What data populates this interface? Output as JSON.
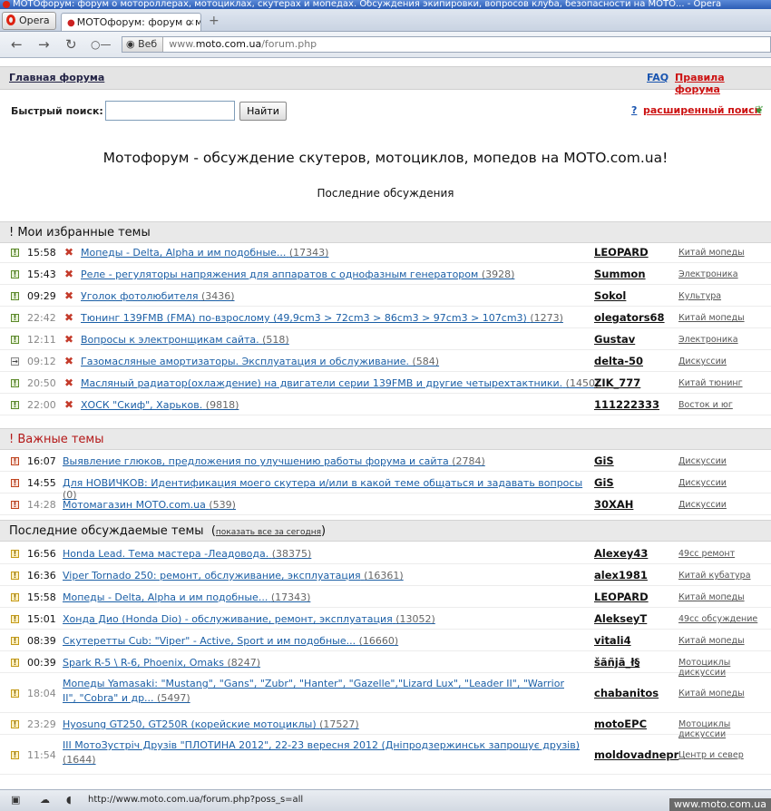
{
  "window": {
    "title": "МОТОфорум: форум о мотороллерах, мотоциклах, скутерах и мопедах. Обсуждения экипировки, вопросов клуба, безопасности на МОТО... - Opera"
  },
  "browser": {
    "opera_label": "Opera",
    "tab_label": "МОТОфорум: форум о м...",
    "tab_close": "×",
    "new_tab": "+",
    "web_label": "Веб",
    "url_prefix": "www.",
    "url_host": "moto.com.ua",
    "url_path": "/forum.php"
  },
  "nav": {
    "home": "Главная форума",
    "faq": "FAQ",
    "rules": "Правила форума"
  },
  "search": {
    "label": "Быстрый поиск:",
    "value": "",
    "button": "Найти",
    "adv_help": "?",
    "advanced": "расширенный поиск"
  },
  "headline": "Мотофорум - обсуждение скутеров, мотоциклов, мопедов на MOTO.com.ua!",
  "subhead": "Последние обсуждения",
  "sections": {
    "favorites": {
      "title": "! Мои избранные темы"
    },
    "important": {
      "title": "! Важные темы"
    },
    "recent": {
      "title": "Последние обсуждаемые темы",
      "open": "(",
      "show_all": "показать все за сегодня",
      "close": ")"
    }
  },
  "rows": [
    {
      "icon": "!",
      "time": "15:58",
      "old": false,
      "del": true,
      "title": "Мопеды - Delta, Alpha и им подобные...",
      "count": "(17343)",
      "author": "LEOPARD",
      "cat": "Китай мопеды"
    },
    {
      "icon": "!",
      "time": "15:43",
      "old": false,
      "del": true,
      "title": "Реле - регуляторы напряжения для аппаратов с однофазным генератором",
      "count": "(3928)",
      "author": "Summon",
      "cat": "Электроника"
    },
    {
      "icon": "!",
      "time": "09:29",
      "old": false,
      "del": true,
      "title": "Уголок фотолюбителя",
      "count": "(3436)",
      "author": "Sokol",
      "cat": "Культура"
    },
    {
      "icon": "!",
      "time": "22:42",
      "old": true,
      "del": true,
      "title": "Тюнинг 139FMB (FMA) по-взрослому (49,9cm3 > 72cm3 > 86cm3 > 97cm3 > 107cm3)",
      "count": "(1273)",
      "author": "olegators68",
      "cat": "Китай мопеды"
    },
    {
      "icon": "!",
      "time": "12:11",
      "old": true,
      "del": true,
      "title": "Вопросы к электронщикам сайта.",
      "count": "(518)",
      "author": "Gustav",
      "cat": "Электроника"
    },
    {
      "icon": "→",
      "time": "09:12",
      "old": true,
      "del": true,
      "title": "Газомасляные амортизаторы. Эксплуатация и обслуживание.",
      "count": "(584)",
      "author": "delta-50",
      "cat": "Дискуссии"
    },
    {
      "icon": "!",
      "time": "20:50",
      "old": true,
      "del": true,
      "title": "Масляный радиатор(охлаждение) на двигатели серии 139FMB и другие четырехтактники.",
      "count": "(1450)",
      "author": "ZIK_777",
      "cat": "Китай тюнинг"
    },
    {
      "icon": "!",
      "time": "22:00",
      "old": true,
      "del": true,
      "title": "ХОСК \"Скиф\", Харьков.",
      "count": "(9818)",
      "author": "111222333",
      "cat": "Восток и юг"
    },
    {
      "icon": "!",
      "time": "16:07",
      "old": false,
      "del": false,
      "title": "Выявление глюков, предложения по улучшению работы форума и сайта",
      "count": "(2784)",
      "author": "GiS",
      "cat": "Дискуссии"
    },
    {
      "icon": "!",
      "time": "14:55",
      "old": false,
      "del": false,
      "title": "Для НОВИЧКОВ: Идентификация моего скутера и/или в какой теме общаться и задавать вопросы",
      "count": "(0)",
      "author": "GiS",
      "cat": "Дискуссии"
    },
    {
      "icon": "!",
      "time": "14:28",
      "old": true,
      "del": false,
      "title": "Мотомагазин MOTO.com.ua",
      "count": "(539)",
      "author": "30XAH",
      "cat": "Дискуссии"
    },
    {
      "icon": "!",
      "time": "16:56",
      "old": false,
      "del": false,
      "title": "Honda Lead. Тема мастера -Леадовода.",
      "count": "(38375)",
      "author": "Alexey43",
      "cat": "49cc ремонт"
    },
    {
      "icon": "!",
      "time": "16:36",
      "old": false,
      "del": false,
      "title": "Viper Tornado 250: ремонт, обслуживание, эксплуатация",
      "count": "(16361)",
      "author": "alex1981",
      "cat": "Китай кубатура"
    },
    {
      "icon": "!",
      "time": "15:58",
      "old": false,
      "del": false,
      "title": "Мопеды - Delta, Alpha и им подобные...",
      "count": "(17343)",
      "author": "LEOPARD",
      "cat": "Китай мопеды"
    },
    {
      "icon": "!",
      "time": "15:01",
      "old": false,
      "del": false,
      "title": "Хонда Дио (Honda Dio) - обслуживание, ремонт, эксплуатация",
      "count": "(13052)",
      "author": "AlekseyT",
      "cat": "49cc обсуждение"
    },
    {
      "icon": "!",
      "time": "08:39",
      "old": false,
      "del": false,
      "title": "Скутеретты Cub: \"Viper\" - Active, Sport и им подобные...",
      "count": "(16660)",
      "author": "vitali4",
      "cat": "Китай мопеды"
    },
    {
      "icon": "!",
      "time": "00:39",
      "old": false,
      "del": false,
      "title": "Spark R-5 \\ R-6, Phoenix, Omaks",
      "count": "(8247)",
      "author": "šãñjã_ł§",
      "cat": "Мотоциклы дискуссии"
    },
    {
      "icon": "!",
      "time": "18:04",
      "old": true,
      "del": false,
      "title": "Мопеды Yamasaki: \"Mustang\", \"Gans\", \"Zubr\", \"Hanter\", \"Gazelle\",\"Lizard Lux\", \"Leader II\", \"Warrior II\", \"Cobra\" и др...",
      "count": "(5497)",
      "author": "chabanitos",
      "cat": "Китай мопеды"
    },
    {
      "icon": "!",
      "time": "23:29",
      "old": true,
      "del": false,
      "title": "Hyosung GT250, GT250R (корейские мотоциклы)",
      "count": "(17527)",
      "author": "motoEPC",
      "cat": "Мотоциклы дискуссии"
    },
    {
      "icon": "!",
      "time": "11:54",
      "old": true,
      "del": false,
      "title": "III МотоЗустріч Друзів \"ПЛОТИНА 2012\", 22-23 вересня 2012 (Днiпродзержинськ запрошує друзів)",
      "count": "(1644)",
      "author": "moldovadnepr",
      "cat": "Центр и север"
    }
  ],
  "status": {
    "url": "http://www.moto.com.ua/forum.php?poss_s=all",
    "watermark": "www.moto.com.ua"
  }
}
